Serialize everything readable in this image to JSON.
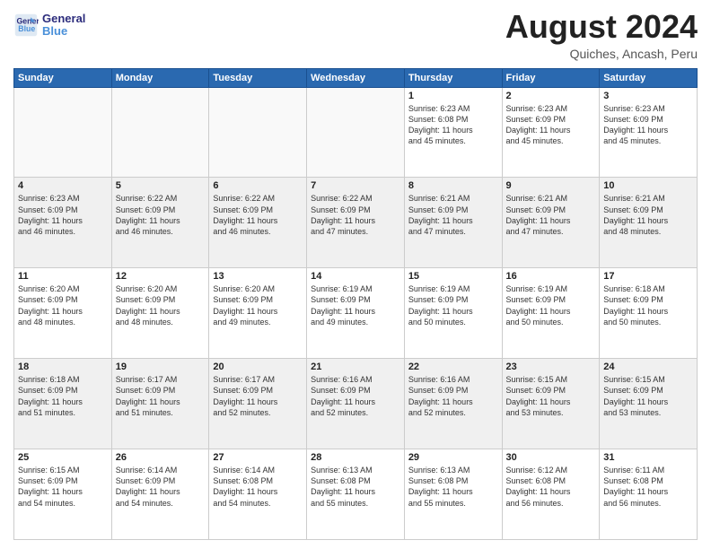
{
  "header": {
    "logo_line1": "General",
    "logo_line2": "Blue",
    "title": "August 2024",
    "subtitle": "Quiches, Ancash, Peru"
  },
  "days_of_week": [
    "Sunday",
    "Monday",
    "Tuesday",
    "Wednesday",
    "Thursday",
    "Friday",
    "Saturday"
  ],
  "weeks": [
    [
      {
        "day": "",
        "info": ""
      },
      {
        "day": "",
        "info": ""
      },
      {
        "day": "",
        "info": ""
      },
      {
        "day": "",
        "info": ""
      },
      {
        "day": "1",
        "info": "Sunrise: 6:23 AM\nSunset: 6:08 PM\nDaylight: 11 hours\nand 45 minutes."
      },
      {
        "day": "2",
        "info": "Sunrise: 6:23 AM\nSunset: 6:09 PM\nDaylight: 11 hours\nand 45 minutes."
      },
      {
        "day": "3",
        "info": "Sunrise: 6:23 AM\nSunset: 6:09 PM\nDaylight: 11 hours\nand 45 minutes."
      }
    ],
    [
      {
        "day": "4",
        "info": "Sunrise: 6:23 AM\nSunset: 6:09 PM\nDaylight: 11 hours\nand 46 minutes."
      },
      {
        "day": "5",
        "info": "Sunrise: 6:22 AM\nSunset: 6:09 PM\nDaylight: 11 hours\nand 46 minutes."
      },
      {
        "day": "6",
        "info": "Sunrise: 6:22 AM\nSunset: 6:09 PM\nDaylight: 11 hours\nand 46 minutes."
      },
      {
        "day": "7",
        "info": "Sunrise: 6:22 AM\nSunset: 6:09 PM\nDaylight: 11 hours\nand 47 minutes."
      },
      {
        "day": "8",
        "info": "Sunrise: 6:21 AM\nSunset: 6:09 PM\nDaylight: 11 hours\nand 47 minutes."
      },
      {
        "day": "9",
        "info": "Sunrise: 6:21 AM\nSunset: 6:09 PM\nDaylight: 11 hours\nand 47 minutes."
      },
      {
        "day": "10",
        "info": "Sunrise: 6:21 AM\nSunset: 6:09 PM\nDaylight: 11 hours\nand 48 minutes."
      }
    ],
    [
      {
        "day": "11",
        "info": "Sunrise: 6:20 AM\nSunset: 6:09 PM\nDaylight: 11 hours\nand 48 minutes."
      },
      {
        "day": "12",
        "info": "Sunrise: 6:20 AM\nSunset: 6:09 PM\nDaylight: 11 hours\nand 48 minutes."
      },
      {
        "day": "13",
        "info": "Sunrise: 6:20 AM\nSunset: 6:09 PM\nDaylight: 11 hours\nand 49 minutes."
      },
      {
        "day": "14",
        "info": "Sunrise: 6:19 AM\nSunset: 6:09 PM\nDaylight: 11 hours\nand 49 minutes."
      },
      {
        "day": "15",
        "info": "Sunrise: 6:19 AM\nSunset: 6:09 PM\nDaylight: 11 hours\nand 50 minutes."
      },
      {
        "day": "16",
        "info": "Sunrise: 6:19 AM\nSunset: 6:09 PM\nDaylight: 11 hours\nand 50 minutes."
      },
      {
        "day": "17",
        "info": "Sunrise: 6:18 AM\nSunset: 6:09 PM\nDaylight: 11 hours\nand 50 minutes."
      }
    ],
    [
      {
        "day": "18",
        "info": "Sunrise: 6:18 AM\nSunset: 6:09 PM\nDaylight: 11 hours\nand 51 minutes."
      },
      {
        "day": "19",
        "info": "Sunrise: 6:17 AM\nSunset: 6:09 PM\nDaylight: 11 hours\nand 51 minutes."
      },
      {
        "day": "20",
        "info": "Sunrise: 6:17 AM\nSunset: 6:09 PM\nDaylight: 11 hours\nand 52 minutes."
      },
      {
        "day": "21",
        "info": "Sunrise: 6:16 AM\nSunset: 6:09 PM\nDaylight: 11 hours\nand 52 minutes."
      },
      {
        "day": "22",
        "info": "Sunrise: 6:16 AM\nSunset: 6:09 PM\nDaylight: 11 hours\nand 52 minutes."
      },
      {
        "day": "23",
        "info": "Sunrise: 6:15 AM\nSunset: 6:09 PM\nDaylight: 11 hours\nand 53 minutes."
      },
      {
        "day": "24",
        "info": "Sunrise: 6:15 AM\nSunset: 6:09 PM\nDaylight: 11 hours\nand 53 minutes."
      }
    ],
    [
      {
        "day": "25",
        "info": "Sunrise: 6:15 AM\nSunset: 6:09 PM\nDaylight: 11 hours\nand 54 minutes."
      },
      {
        "day": "26",
        "info": "Sunrise: 6:14 AM\nSunset: 6:09 PM\nDaylight: 11 hours\nand 54 minutes."
      },
      {
        "day": "27",
        "info": "Sunrise: 6:14 AM\nSunset: 6:08 PM\nDaylight: 11 hours\nand 54 minutes."
      },
      {
        "day": "28",
        "info": "Sunrise: 6:13 AM\nSunset: 6:08 PM\nDaylight: 11 hours\nand 55 minutes."
      },
      {
        "day": "29",
        "info": "Sunrise: 6:13 AM\nSunset: 6:08 PM\nDaylight: 11 hours\nand 55 minutes."
      },
      {
        "day": "30",
        "info": "Sunrise: 6:12 AM\nSunset: 6:08 PM\nDaylight: 11 hours\nand 56 minutes."
      },
      {
        "day": "31",
        "info": "Sunrise: 6:11 AM\nSunset: 6:08 PM\nDaylight: 11 hours\nand 56 minutes."
      }
    ]
  ]
}
